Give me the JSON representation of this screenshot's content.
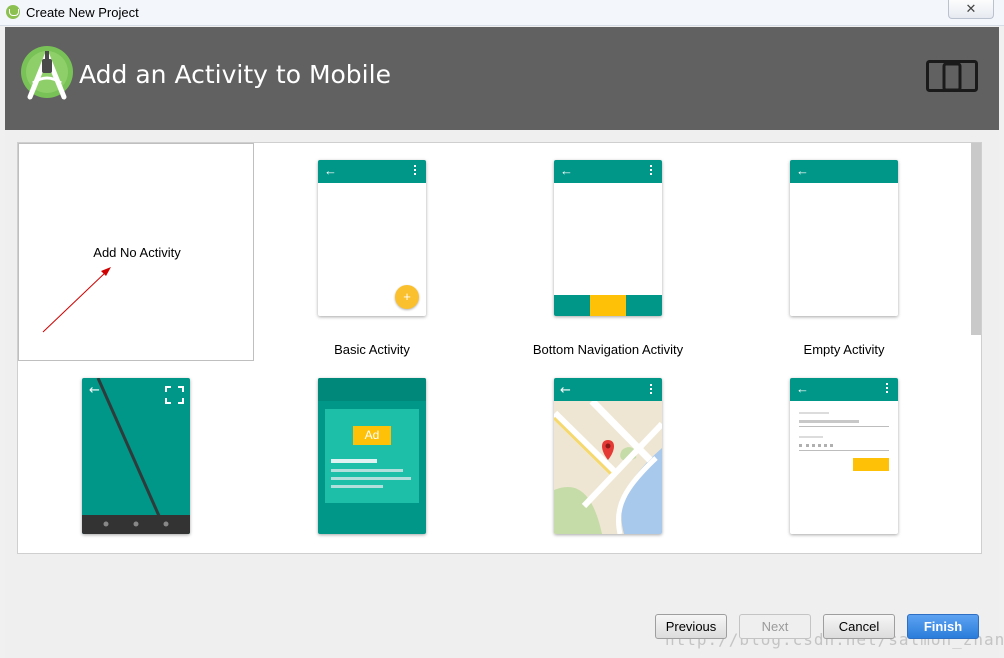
{
  "window": {
    "title": "Create New Project",
    "close_symbol": "✕"
  },
  "header": {
    "title": "Add an Activity to Mobile",
    "logo_icon": "android-studio-icon",
    "device_icon": "phone-tablet-icon",
    "background_color": "#616161"
  },
  "templates": [
    {
      "label": "Add No Activity"
    },
    {
      "label": "Basic Activity"
    },
    {
      "label": "Bottom Navigation Activity"
    },
    {
      "label": "Empty Activity"
    },
    {
      "label": ""
    },
    {
      "label": ""
    },
    {
      "label": ""
    },
    {
      "label": ""
    }
  ],
  "ad_badge": "Ad",
  "accent_colors": {
    "teal": "#009688",
    "amber": "#ffc107",
    "fab": "#fbc02d"
  },
  "buttons": {
    "previous": "Previous",
    "next": "Next",
    "cancel": "Cancel",
    "finish": "Finish"
  },
  "watermark": "http://blog.csdn.net/salmon_zhang"
}
